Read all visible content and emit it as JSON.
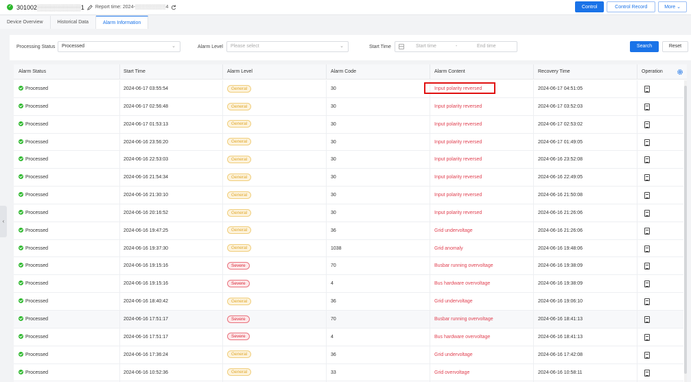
{
  "header": {
    "device_id_prefix": "301002",
    "device_id_blur": "▒▒▒▒▒▒▒▒▒▒",
    "device_id_suffix": "1",
    "report_label": "Report time: 2024-",
    "report_blur": "▒▒▒▒▒▒▒▒▒",
    "report_suffix": "4",
    "buttons": {
      "control": "Control",
      "control_record": "Control Record",
      "more": "More"
    }
  },
  "tabs": [
    {
      "label": "Device Overview",
      "active": false
    },
    {
      "label": "Historical Data",
      "active": false
    },
    {
      "label": "Alarm Information",
      "active": true
    }
  ],
  "filters": {
    "processing_status_label": "Processing Status",
    "processing_status_value": "Processed",
    "alarm_level_label": "Alarm Level",
    "alarm_level_placeholder": "Please select",
    "start_time_label": "Start Time",
    "start_time_placeholder": "Start time",
    "separator": "-",
    "end_time_placeholder": "End time",
    "search": "Search",
    "reset": "Reset"
  },
  "table": {
    "columns": [
      "Alarm Status",
      "Start Time",
      "Alarm Level",
      "Alarm Code",
      "Alarm Content",
      "Recovery Time",
      "Operation"
    ],
    "rows": [
      {
        "status": "Processed",
        "start": "2024-06-17 03:55:54",
        "level": "General",
        "code": "30",
        "content": "Input polarity reversed",
        "recovery": "2024-06-17 04:51:05"
      },
      {
        "status": "Processed",
        "start": "2024-06-17 02:56:48",
        "level": "General",
        "code": "30",
        "content": "Input polarity reversed",
        "recovery": "2024-06-17 03:52:03"
      },
      {
        "status": "Processed",
        "start": "2024-06-17 01:53:13",
        "level": "General",
        "code": "30",
        "content": "Input polarity reversed",
        "recovery": "2024-06-17 02:53:02"
      },
      {
        "status": "Processed",
        "start": "2024-06-16 23:56:20",
        "level": "General",
        "code": "30",
        "content": "Input polarity reversed",
        "recovery": "2024-06-17 01:49:05"
      },
      {
        "status": "Processed",
        "start": "2024-06-16 22:53:03",
        "level": "General",
        "code": "30",
        "content": "Input polarity reversed",
        "recovery": "2024-06-16 23:52:08"
      },
      {
        "status": "Processed",
        "start": "2024-06-16 21:54:34",
        "level": "General",
        "code": "30",
        "content": "Input polarity reversed",
        "recovery": "2024-06-16 22:49:05"
      },
      {
        "status": "Processed",
        "start": "2024-06-16 21:30:10",
        "level": "General",
        "code": "30",
        "content": "Input polarity reversed",
        "recovery": "2024-06-16 21:50:08"
      },
      {
        "status": "Processed",
        "start": "2024-06-16 20:16:52",
        "level": "General",
        "code": "30",
        "content": "Input polarity reversed",
        "recovery": "2024-06-16 21:26:06"
      },
      {
        "status": "Processed",
        "start": "2024-06-16 19:47:25",
        "level": "General",
        "code": "36",
        "content": "Grid undervoltage",
        "recovery": "2024-06-16 21:26:06"
      },
      {
        "status": "Processed",
        "start": "2024-06-16 19:37:30",
        "level": "General",
        "code": "1038",
        "content": "Grid anomaly",
        "recovery": "2024-06-16 19:48:06"
      },
      {
        "status": "Processed",
        "start": "2024-06-16 19:15:16",
        "level": "Severe",
        "code": "70",
        "content": "Busbar running overvoltage",
        "recovery": "2024-06-16 19:38:09"
      },
      {
        "status": "Processed",
        "start": "2024-06-16 19:15:16",
        "level": "Severe",
        "code": "4",
        "content": "Bus hardware overvoltage",
        "recovery": "2024-06-16 19:38:09"
      },
      {
        "status": "Processed",
        "start": "2024-06-16 18:40:42",
        "level": "General",
        "code": "36",
        "content": "Grid undervoltage",
        "recovery": "2024-06-16 19:06:10"
      },
      {
        "status": "Processed",
        "start": "2024-06-16 17:51:17",
        "level": "Severe",
        "code": "70",
        "content": "Busbar running overvoltage",
        "recovery": "2024-06-16 18:41:13"
      },
      {
        "status": "Processed",
        "start": "2024-06-16 17:51:17",
        "level": "Severe",
        "code": "4",
        "content": "Bus hardware overvoltage",
        "recovery": "2024-06-16 18:41:13"
      },
      {
        "status": "Processed",
        "start": "2024-06-16 17:36:24",
        "level": "General",
        "code": "36",
        "content": "Grid undervoltage",
        "recovery": "2024-06-16 17:42:08"
      },
      {
        "status": "Processed",
        "start": "2024-06-16 10:52:36",
        "level": "General",
        "code": "33",
        "content": "Grid overvoltage",
        "recovery": "2024-06-16 10:58:11"
      }
    ]
  },
  "colors": {
    "primary": "#1a73e8",
    "processed": "#2eb82e",
    "general": "#e0a82e",
    "severe": "#d92b3a",
    "alarm_content": "#e04050",
    "highlight": "#e01010"
  }
}
